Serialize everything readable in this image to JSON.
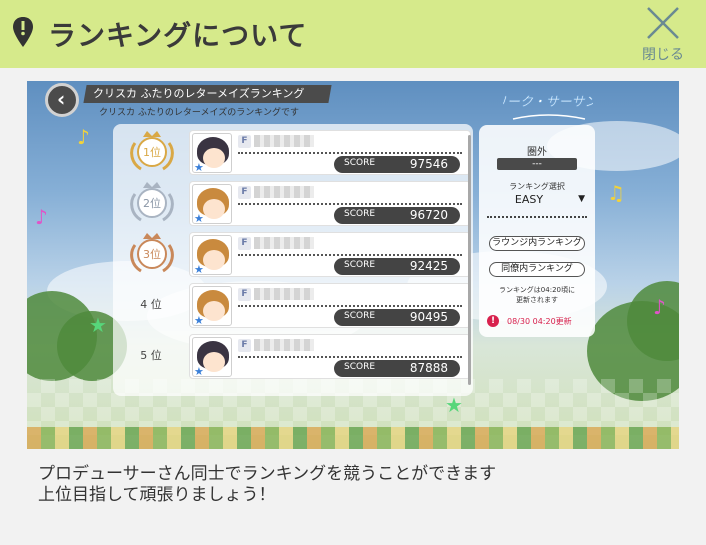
{
  "header": {
    "title": "ランキングについて",
    "close_label": "閉じる"
  },
  "game": {
    "title": "クリスカ ふたりのレターメイズランキング",
    "subtitle": "クリスカ ふたりのレターメイズのランキングです",
    "rows": [
      {
        "rank_label": "1位",
        "medal": "gold",
        "score_label": "SCORE",
        "score": "97546"
      },
      {
        "rank_label": "2位",
        "medal": "silver",
        "score_label": "SCORE",
        "score": "96720"
      },
      {
        "rank_label": "3位",
        "medal": "bronze",
        "score_label": "SCORE",
        "score": "92425"
      },
      {
        "rank_label": "4 位",
        "medal": "",
        "score_label": "SCORE",
        "score": "90495"
      },
      {
        "rank_label": "5 位",
        "medal": "",
        "score_label": "SCORE",
        "score": "87888"
      }
    ],
    "rank_badge": "F",
    "side": {
      "logo": "2リーク・サーサンシ",
      "my_rank": "圏外",
      "my_rank_value": "---",
      "select_label": "ランキング選択",
      "select_value": "EASY",
      "btn_lounge": "ラウンジ内ランキング",
      "btn_colleague": "同僚内ランキング",
      "note_line1": "ランキングは04:20頃に",
      "note_line2": "更新されます",
      "update_text": "08/30 04:20更新"
    }
  },
  "description": {
    "line1": "プロデューサーさん同士でランキングを競うことができます",
    "line2": "上位目指して頑張りましょう！"
  },
  "colors": {
    "header_bg": "#d6ea8b",
    "alert_red": "#d8214d",
    "score_pill": "#444444",
    "gold": "#d9a845",
    "silver": "#a9b4c2",
    "bronze": "#c9885a"
  }
}
